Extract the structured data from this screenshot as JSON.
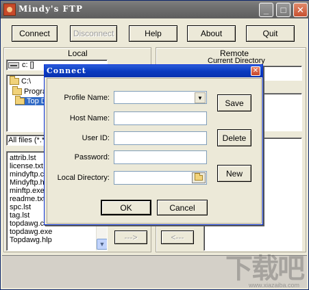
{
  "window": {
    "title": "Mindy's FTP"
  },
  "toolbar": {
    "connect": "Connect",
    "disconnect": "Disconnect",
    "help": "Help",
    "about": "About",
    "quit": "Quit"
  },
  "local": {
    "label": "Local",
    "drive": "c: []",
    "tree": [
      "C:\\",
      "Progra",
      "Top D"
    ],
    "filter": "All files (*.*)",
    "files": [
      "attrib.lst",
      "license.txt",
      "mindyftp.cn",
      "Mindyftp.hlp",
      "minftp.exe",
      "readme.txt",
      "spc.lst",
      "tag.lst",
      "topdawg.cnt",
      "topdawg.exe",
      "Topdawg.hlp"
    ]
  },
  "remote": {
    "label": "Remote",
    "current_dir_label": "Current Directory"
  },
  "transfer": {
    "upload": "--->",
    "download": "<---"
  },
  "dialog": {
    "title": "Connect",
    "profile_label": "Profile Name:",
    "host_label": "Host Name:",
    "userid_label": "User ID:",
    "password_label": "Password:",
    "localdir_label": "Local Directory:",
    "profile_value": "",
    "host_value": "",
    "userid_value": "",
    "password_value": "",
    "localdir_value": "",
    "save": "Save",
    "delete": "Delete",
    "new": "New",
    "ok": "OK",
    "cancel": "Cancel"
  },
  "watermark": {
    "text": "下载吧",
    "url": "www.xiazaiba.com"
  },
  "colors": {
    "dialog_title": "#0a3bc0",
    "selection": "#316ac5",
    "main_title_inactive": "#6e6e6e"
  }
}
